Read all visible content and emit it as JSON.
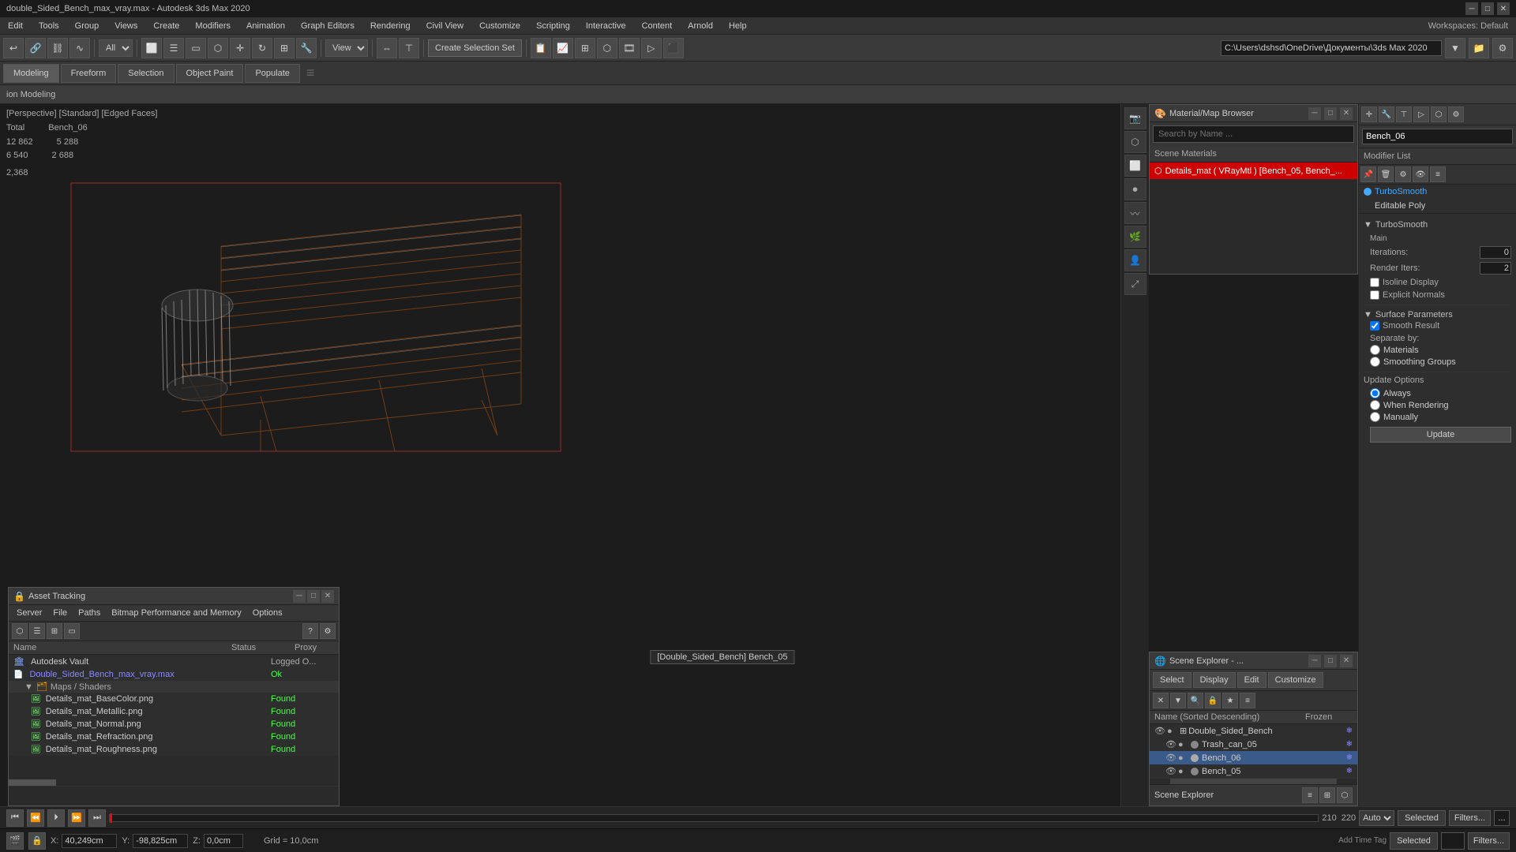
{
  "titlebar": {
    "title": "double_Sided_Bench_max_vray.max - Autodesk 3ds Max 2020",
    "min": "─",
    "max": "□",
    "close": "✕"
  },
  "menubar": {
    "items": [
      "Edit",
      "Tools",
      "Group",
      "Views",
      "Create",
      "Modifiers",
      "Animation",
      "Graph Editors",
      "Rendering",
      "Civil View",
      "Customize",
      "Scripting",
      "Interactive",
      "Content",
      "Arnold",
      "Help"
    ],
    "workspace": "Workspaces:  Default"
  },
  "toolbar": {
    "filter_dropdown": "All",
    "view_dropdown": "View",
    "create_selection_btn": "Create Selection Set"
  },
  "tabs": {
    "modeling": "Modeling",
    "freeform": "Freeform",
    "selection": "Selection",
    "object_paint": "Object Paint",
    "populate": "Populate"
  },
  "ribbon": {
    "label": "ion Modeling"
  },
  "viewport": {
    "label": "[Perspective] [Standard] [Edged Faces]",
    "stats": {
      "total_label": "Total",
      "total_value": "Bench_06",
      "row1_label": "12 862",
      "row1_value": "5 288",
      "row2_label": "6 540",
      "row2_value": "2 688",
      "extra_value": "2,368"
    },
    "tooltip": "[Double_Sided_Bench] Bench_05"
  },
  "material_browser": {
    "title": "Material/Map Browser",
    "search_placeholder": "Search by Name ...",
    "scene_materials_label": "Scene Materials",
    "material_item": "Details_mat  ( VRayMtl )  [Bench_05, Bench_...",
    "close": "✕",
    "minimize": "─",
    "maximize": "□"
  },
  "scene_explorer": {
    "title": "Scene Explorer - ...",
    "close": "✕",
    "minimize": "─",
    "maximize": "□",
    "toolbar": {
      "select": "Select",
      "display": "Display",
      "edit": "Edit",
      "customize": "Customize"
    },
    "col_name": "Name (Sorted Descending)",
    "col_frozen": "Frozen",
    "items": [
      {
        "name": "Double_Sided_Bench",
        "level": 0,
        "type": "group"
      },
      {
        "name": "Trash_can_05",
        "level": 1,
        "type": "object"
      },
      {
        "name": "Bench_06",
        "level": 1,
        "type": "object",
        "selected": true
      },
      {
        "name": "Bench_05",
        "level": 1,
        "type": "object"
      }
    ],
    "label": "Scene Explorer"
  },
  "asset_tracking": {
    "title": "Asset Tracking",
    "menu": [
      "Server",
      "File",
      "Paths",
      "Bitmap Performance and Memory",
      "Options"
    ],
    "cols": {
      "name": "Name",
      "status": "Status",
      "proxy": "Proxy"
    },
    "items": [
      {
        "name": "Autodesk Vault",
        "status": "Logged O...",
        "type": "vault",
        "level": 0
      },
      {
        "name": "Double_Sided_Bench_max_vray.max",
        "status": "Ok",
        "type": "file",
        "level": 0
      },
      {
        "name": "Maps / Shaders",
        "status": "",
        "type": "folder",
        "level": 1
      },
      {
        "name": "Details_mat_BaseColor.png",
        "status": "Found",
        "type": "png",
        "level": 2
      },
      {
        "name": "Details_mat_Metallic.png",
        "status": "Found",
        "type": "png",
        "level": 2
      },
      {
        "name": "Details_mat_Normal.png",
        "status": "Found",
        "type": "png",
        "level": 2
      },
      {
        "name": "Details_mat_Refraction.png",
        "status": "Found",
        "type": "png",
        "level": 2
      },
      {
        "name": "Details_mat_Roughness.png",
        "status": "Found",
        "type": "png",
        "level": 2
      }
    ]
  },
  "right_panel": {
    "object_name": "Bench_06",
    "modifier_list_label": "Modifier List",
    "modifiers": [
      {
        "name": "TurboSmooth",
        "active": true
      },
      {
        "name": "Editable Poly",
        "active": false
      }
    ],
    "turbosmooth": {
      "section": "TurboSmooth",
      "main_label": "Main",
      "iterations_label": "Iterations:",
      "iterations_value": "0",
      "render_iters_label": "Render Iters:",
      "render_iters_value": "2",
      "isoline_display": "Isoline Display",
      "explicit_normals": "Explicit Normals",
      "surface_params": "Surface Parameters",
      "smooth_result": "Smooth Result",
      "separate_by": "Separate by:",
      "materials": "Materials",
      "smoothing_groups": "Smoothing Groups",
      "update_options": "Update Options",
      "always": "Always",
      "when_rendering": "When Rendering",
      "manually": "Manually",
      "update_btn": "Update"
    }
  },
  "status_bar": {
    "x_label": "X:",
    "x_value": "40,249cm",
    "y_label": "Y:",
    "y_value": "-98,825cm",
    "z_label": "Z:",
    "z_value": "0,0cm",
    "grid": "Grid = 10,0cm",
    "auto": "Auto",
    "selected": "Selected",
    "filters": "Filters..."
  },
  "playback": {
    "frame_start": "210",
    "frame_end": "220"
  }
}
